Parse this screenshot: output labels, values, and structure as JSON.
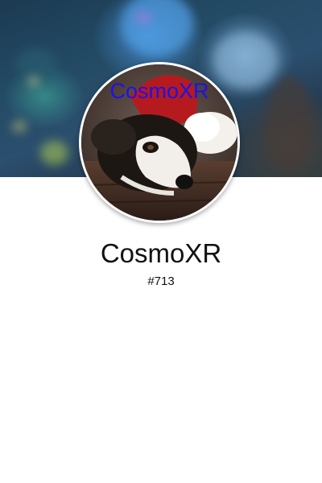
{
  "profile": {
    "avatar_alt_text": "CosmoXR",
    "username": "CosmoXR",
    "user_id": "#713"
  },
  "colors": {
    "background": "#ffffff",
    "alt_text": "#1f10ee",
    "text": "#111111"
  }
}
